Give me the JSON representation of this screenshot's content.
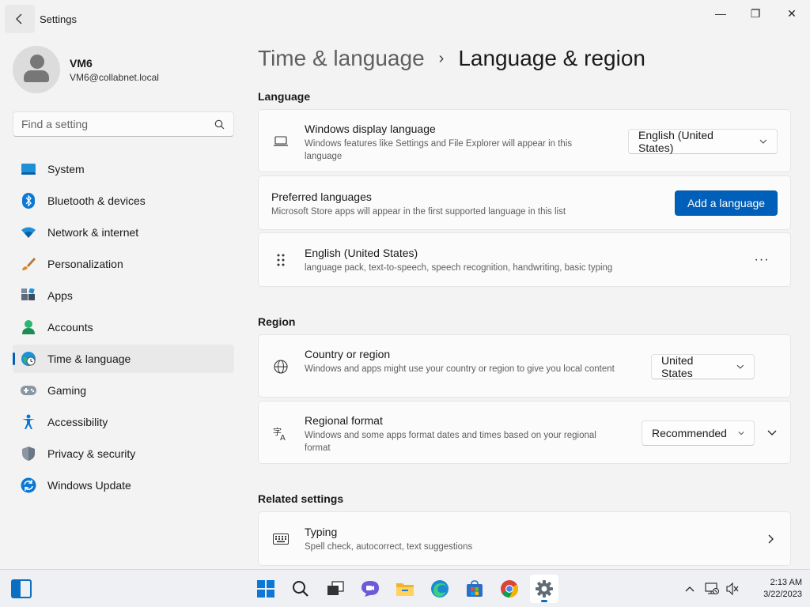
{
  "window": {
    "title": "Settings",
    "minimize": "—",
    "restore": "❐",
    "close": "✕"
  },
  "user": {
    "name": "VM6",
    "email": "VM6@collabnet.local"
  },
  "search": {
    "placeholder": "Find a setting"
  },
  "sidebar": {
    "items": [
      {
        "label": "System",
        "icon": "system-icon"
      },
      {
        "label": "Bluetooth & devices",
        "icon": "bluetooth-icon"
      },
      {
        "label": "Network & internet",
        "icon": "network-icon"
      },
      {
        "label": "Personalization",
        "icon": "brush-icon"
      },
      {
        "label": "Apps",
        "icon": "apps-icon"
      },
      {
        "label": "Accounts",
        "icon": "accounts-icon"
      },
      {
        "label": "Time & language",
        "icon": "time-language-icon",
        "active": true
      },
      {
        "label": "Gaming",
        "icon": "gamepad-icon"
      },
      {
        "label": "Accessibility",
        "icon": "accessibility-icon"
      },
      {
        "label": "Privacy & security",
        "icon": "shield-icon"
      },
      {
        "label": "Windows Update",
        "icon": "update-icon"
      }
    ]
  },
  "breadcrumb": {
    "parent": "Time & language",
    "separator": "›",
    "current": "Language & region"
  },
  "language_section": {
    "title": "Language",
    "display_language": {
      "title": "Windows display language",
      "desc": "Windows features like Settings and File Explorer will appear in this language",
      "value": "English (United States)"
    },
    "preferred": {
      "title": "Preferred languages",
      "desc": "Microsoft Store apps will appear in the first supported language in this list",
      "button": "Add a language"
    },
    "english": {
      "title": "English (United States)",
      "desc": "language pack, text-to-speech, speech recognition, handwriting, basic typing",
      "more": "···"
    }
  },
  "region_section": {
    "title": "Region",
    "country": {
      "title": "Country or region",
      "desc": "Windows and apps might use your country or region to give you local content",
      "value": "United States"
    },
    "format": {
      "title": "Regional format",
      "desc": "Windows and some apps format dates and times based on your regional format",
      "value": "Recommended"
    }
  },
  "related_section": {
    "title": "Related settings",
    "typing": {
      "title": "Typing",
      "desc": "Spell check, autocorrect, text suggestions"
    }
  },
  "taskbar": {
    "time": "2:13 AM",
    "date": "3/22/2023"
  },
  "colors": {
    "accent": "#005fb8"
  }
}
